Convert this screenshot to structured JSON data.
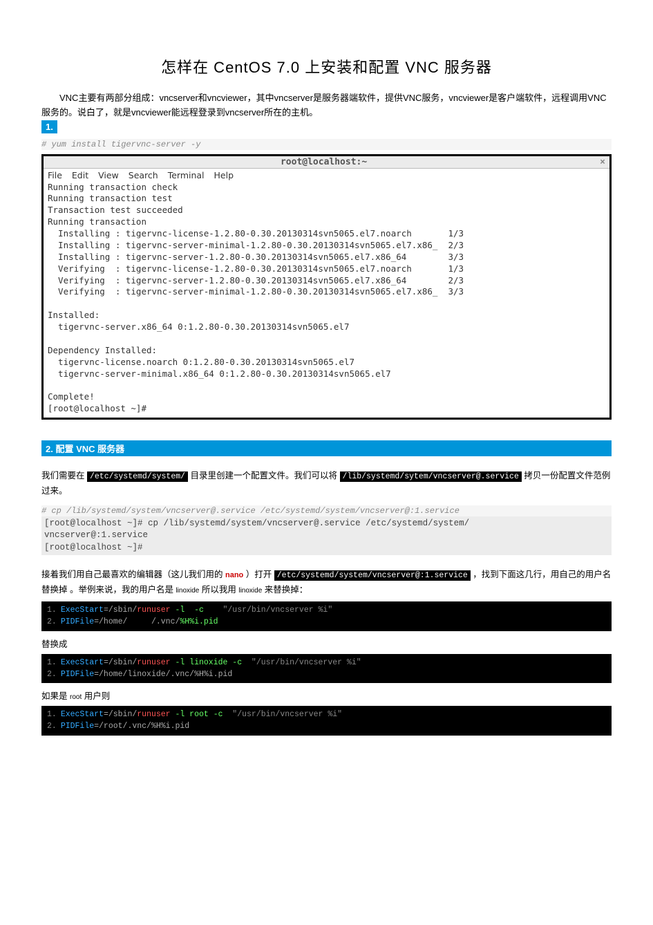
{
  "title": "怎样在 CentOS 7.0 上安装和配置 VNC 服务器",
  "intro": "VNC主要有两部分组成：vncserver和vncviewer，其中vncserver是服务器端软件，提供VNC服务，vncviewer是客户端软件，远程调用VNC服务的。说白了，就是vncviewer能远程登录到vncserver所在的主机。",
  "section1_label": "1.",
  "yum_comment": "# yum install tigervnc-server -y",
  "terminal": {
    "title": "root@localhost:~",
    "close": "×",
    "menus": [
      "File",
      "Edit",
      "View",
      "Search",
      "Terminal",
      "Help"
    ],
    "body": "Running transaction check\nRunning transaction test\nTransaction test succeeded\nRunning transaction\n  Installing : tigervnc-license-1.2.80-0.30.20130314svn5065.el7.noarch       1/3\n  Installing : tigervnc-server-minimal-1.2.80-0.30.20130314svn5065.el7.x86_  2/3\n  Installing : tigervnc-server-1.2.80-0.30.20130314svn5065.el7.x86_64        3/3\n  Verifying  : tigervnc-license-1.2.80-0.30.20130314svn5065.el7.noarch       1/3\n  Verifying  : tigervnc-server-1.2.80-0.30.20130314svn5065.el7.x86_64        2/3\n  Verifying  : tigervnc-server-minimal-1.2.80-0.30.20130314svn5065.el7.x86_  3/3\n\nInstalled:\n  tigervnc-server.x86_64 0:1.2.80-0.30.20130314svn5065.el7\n\nDependency Installed:\n  tigervnc-license.noarch 0:1.2.80-0.30.20130314svn5065.el7\n  tigervnc-server-minimal.x86_64 0:1.2.80-0.30.20130314svn5065.el7\n\nComplete!\n[root@localhost ~]# "
  },
  "section2_label": "2. 配置 VNC 服务器",
  "copy_desc": {
    "pre": "我们需要在",
    "path1": "/etc/systemd/system/",
    "mid": " 目录里创建一个配置文件。我们可以将",
    "path2": "/lib/systemd/sytem/vncserver@.service",
    "post": " 拷贝一份配置文件范例过来。"
  },
  "cp_comment": "#  cp /lib/systemd/system/vncserver@.service /etc/systemd/system/vncserver@:1.service",
  "cp_output": "[root@localhost ~]# cp /lib/systemd/system/vncserver@.service /etc/systemd/system/\nvncserver@:1.service\n[root@localhost ~]# ",
  "edit_desc": {
    "pre": "接着我们用自己最喜欢的编辑器（这儿我们用的",
    "nano": "nano",
    "mid1": "）打开",
    "path": "/etc/systemd/system/vncserver@:1.service",
    "mid2": " ，找到下面这几行，用自己的用户名替换掉 。举例来说，我的用户名是 ",
    "user1": "linoxide",
    "mid3": " 所以我用 ",
    "user2": "linoxide",
    "post": " 来替换掉："
  },
  "code_block1": {
    "l1": {
      "num": "1.",
      "exec": "ExecStart",
      "eq": "=",
      "sbin": "/sbin/",
      "runuser": "runuser",
      "flags": " -l  -c",
      "str": "    \"/usr/bin/vncserver %i\""
    },
    "l2": {
      "num": "2.",
      "pid": "PIDFile",
      "eq": "=",
      "home": "/home/",
      "vnc": "     /.vnc/",
      "file": "%H%i.pid"
    }
  },
  "replace_label": "替换成",
  "code_block2": {
    "l1": {
      "num": "1.",
      "exec": "ExecStart",
      "eq": "=",
      "sbin": "/sbin/",
      "runuser": "runuser",
      "flags": " -l linoxide -c",
      "str": "  \"/usr/bin/vncserver %i\""
    },
    "l2": {
      "num": "2.",
      "pid": "PIDFile",
      "eq": "=",
      "home": "/home/",
      "vnc": "linoxide/.vnc/%H%i.pid"
    }
  },
  "root_label_pre": "如果是 ",
  "root_label_root": "root",
  "root_label_post": " 用户则",
  "code_block3": {
    "l1": {
      "num": "1.",
      "exec": "ExecStart",
      "eq": "=",
      "sbin": "/sbin/",
      "runuser": "runuser",
      "flags": " -l root -c",
      "str": "  \"/usr/bin/vncserver %i\""
    },
    "l2": {
      "num": "2.",
      "pid": "PIDFile",
      "eq": "=",
      "root": "/root/",
      "vnc": ".vnc/%H%i.pid"
    }
  }
}
